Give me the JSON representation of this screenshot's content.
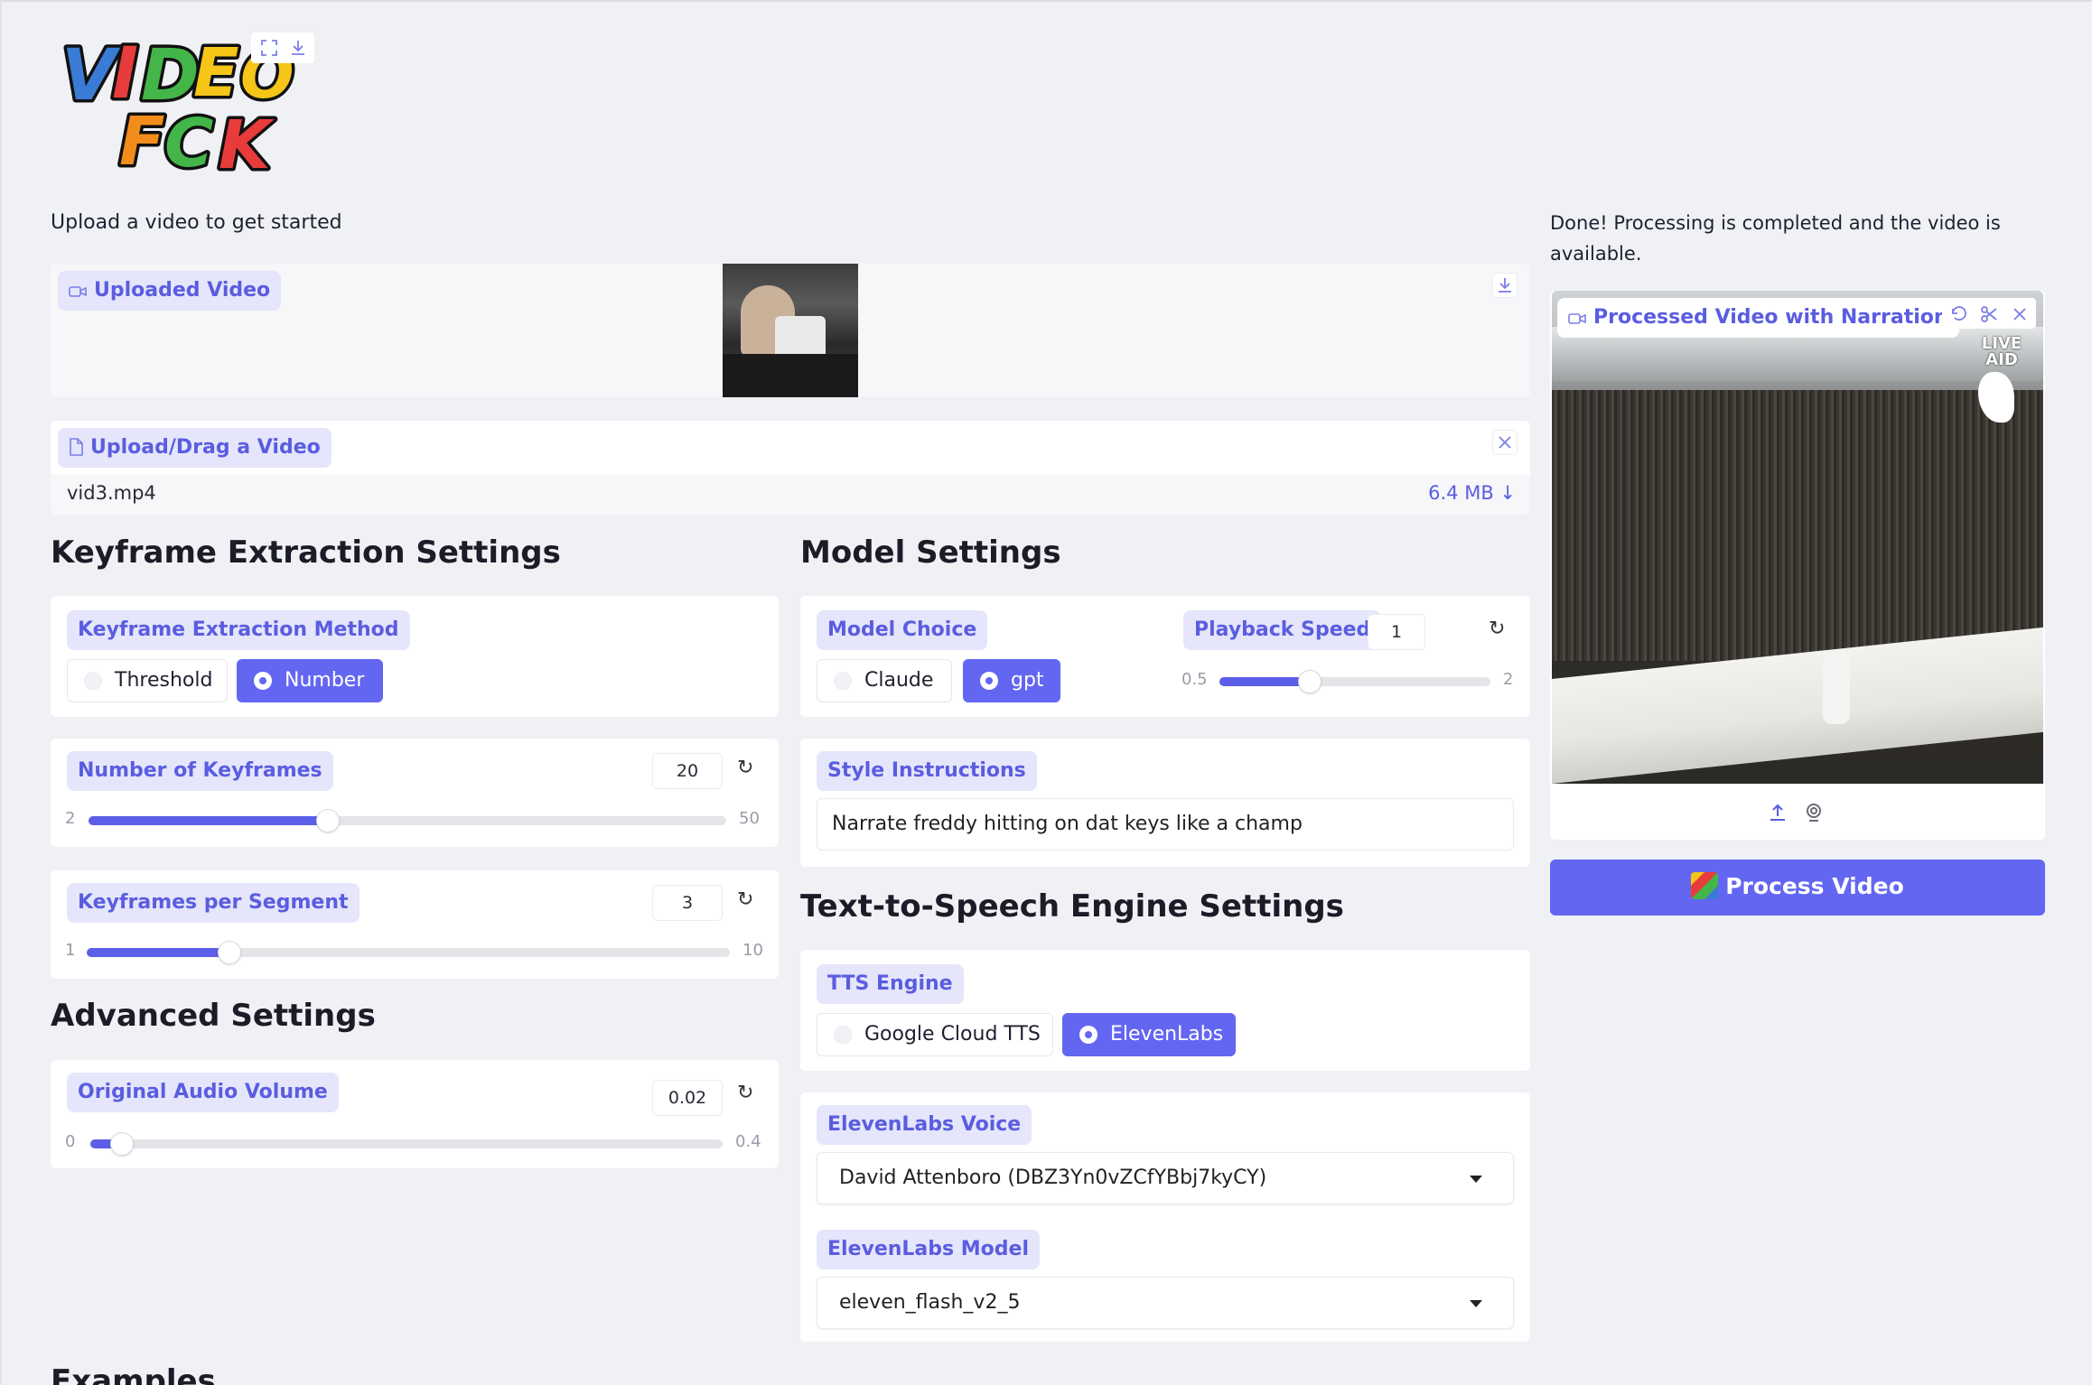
{
  "app": {
    "logo_line1": "VIDEO",
    "logo_line2": "FCK"
  },
  "upload": {
    "prompt": "Upload a video to get started",
    "uploaded_video_label": "Uploaded Video",
    "upload_label": "Upload/Drag a Video",
    "file_name": "vid3.mp4",
    "file_size": "6.4 MB ↓"
  },
  "keyframe": {
    "heading": "Keyframe Extraction Settings",
    "method_label": "Keyframe Extraction Method",
    "options": [
      "Threshold",
      "Number"
    ],
    "selected": "Number",
    "num_keyframes": {
      "label": "Number of Keyframes",
      "value": "20",
      "min": "2",
      "max": "50",
      "fraction": 0.375
    },
    "per_segment": {
      "label": "Keyframes per Segment",
      "value": "3",
      "min": "1",
      "max": "10",
      "fraction": 0.222
    }
  },
  "advanced": {
    "heading": "Advanced Settings",
    "audio_volume": {
      "label": "Original Audio Volume",
      "value": "0.02",
      "min": "0",
      "max": "0.4",
      "fraction": 0.05
    }
  },
  "model": {
    "heading": "Model Settings",
    "choice_label": "Model Choice",
    "options": [
      "Claude",
      "gpt"
    ],
    "selected": "gpt",
    "playback": {
      "label": "Playback Speed",
      "value": "1",
      "min": "0.5",
      "max": "2",
      "fraction": 0.333
    },
    "style_label": "Style Instructions",
    "style_value": "Narrate freddy hitting on dat keys like a champ"
  },
  "tts": {
    "heading": "Text-to-Speech Engine Settings",
    "engine_label": "TTS Engine",
    "options": [
      "Google Cloud TTS",
      "ElevenLabs"
    ],
    "selected": "ElevenLabs",
    "voice_label": "ElevenLabs Voice",
    "voice_value": "David Attenboro (DBZ3Yn0vZCfYBbj7kyCY)",
    "model_label": "ElevenLabs Model",
    "model_value": "eleven_flash_v2_5"
  },
  "output": {
    "status": "Done! Processing is completed and the video is available.",
    "video_label": "Processed Video with Narration",
    "overlay_text": "LIVE AID",
    "process_button": "Process Video"
  },
  "examples": {
    "heading": "Examples"
  },
  "colors": {
    "accent": "#6366f1",
    "badge_bg": "#e5e6fb",
    "badge_text": "#5a5de0",
    "page_bg": "#f0f1f5"
  }
}
